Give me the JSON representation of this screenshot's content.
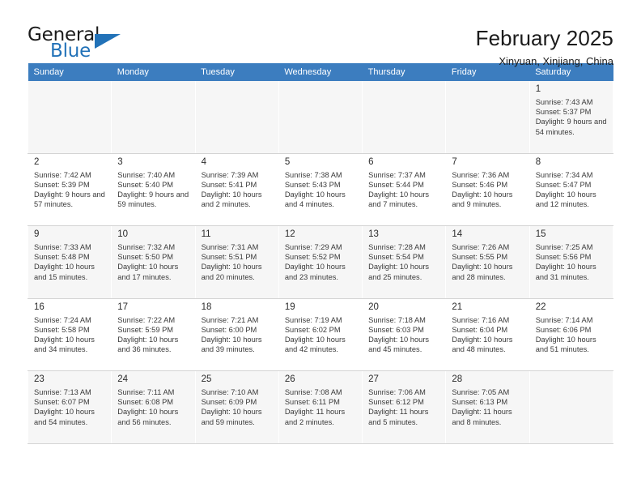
{
  "brand": {
    "name_top": "General",
    "name_bottom": "Blue",
    "accent_color": "#2272b8"
  },
  "header": {
    "title": "February 2025",
    "subtitle": "Xinyuan, Xinjiang, China"
  },
  "theme": {
    "header_row_bg": "#3c7dbf",
    "alt_row_bg": "#f6f6f6",
    "empty_cell_bg": "#f1f1f1"
  },
  "weekdays": [
    "Sunday",
    "Monday",
    "Tuesday",
    "Wednesday",
    "Thursday",
    "Friday",
    "Saturday"
  ],
  "labels": {
    "sunrise_prefix": "Sunrise: ",
    "sunset_prefix": "Sunset: ",
    "daylight_prefix": "Daylight: "
  },
  "weeks": [
    [
      {
        "empty": true
      },
      {
        "empty": true
      },
      {
        "empty": true
      },
      {
        "empty": true
      },
      {
        "empty": true
      },
      {
        "empty": true
      },
      {
        "day": "1",
        "sunrise": "Sunrise: 7:43 AM",
        "sunset": "Sunset: 5:37 PM",
        "daylight": "Daylight: 9 hours and 54 minutes."
      }
    ],
    [
      {
        "day": "2",
        "sunrise": "Sunrise: 7:42 AM",
        "sunset": "Sunset: 5:39 PM",
        "daylight": "Daylight: 9 hours and 57 minutes."
      },
      {
        "day": "3",
        "sunrise": "Sunrise: 7:40 AM",
        "sunset": "Sunset: 5:40 PM",
        "daylight": "Daylight: 9 hours and 59 minutes."
      },
      {
        "day": "4",
        "sunrise": "Sunrise: 7:39 AM",
        "sunset": "Sunset: 5:41 PM",
        "daylight": "Daylight: 10 hours and 2 minutes."
      },
      {
        "day": "5",
        "sunrise": "Sunrise: 7:38 AM",
        "sunset": "Sunset: 5:43 PM",
        "daylight": "Daylight: 10 hours and 4 minutes."
      },
      {
        "day": "6",
        "sunrise": "Sunrise: 7:37 AM",
        "sunset": "Sunset: 5:44 PM",
        "daylight": "Daylight: 10 hours and 7 minutes."
      },
      {
        "day": "7",
        "sunrise": "Sunrise: 7:36 AM",
        "sunset": "Sunset: 5:46 PM",
        "daylight": "Daylight: 10 hours and 9 minutes."
      },
      {
        "day": "8",
        "sunrise": "Sunrise: 7:34 AM",
        "sunset": "Sunset: 5:47 PM",
        "daylight": "Daylight: 10 hours and 12 minutes."
      }
    ],
    [
      {
        "day": "9",
        "sunrise": "Sunrise: 7:33 AM",
        "sunset": "Sunset: 5:48 PM",
        "daylight": "Daylight: 10 hours and 15 minutes."
      },
      {
        "day": "10",
        "sunrise": "Sunrise: 7:32 AM",
        "sunset": "Sunset: 5:50 PM",
        "daylight": "Daylight: 10 hours and 17 minutes."
      },
      {
        "day": "11",
        "sunrise": "Sunrise: 7:31 AM",
        "sunset": "Sunset: 5:51 PM",
        "daylight": "Daylight: 10 hours and 20 minutes."
      },
      {
        "day": "12",
        "sunrise": "Sunrise: 7:29 AM",
        "sunset": "Sunset: 5:52 PM",
        "daylight": "Daylight: 10 hours and 23 minutes."
      },
      {
        "day": "13",
        "sunrise": "Sunrise: 7:28 AM",
        "sunset": "Sunset: 5:54 PM",
        "daylight": "Daylight: 10 hours and 25 minutes."
      },
      {
        "day": "14",
        "sunrise": "Sunrise: 7:26 AM",
        "sunset": "Sunset: 5:55 PM",
        "daylight": "Daylight: 10 hours and 28 minutes."
      },
      {
        "day": "15",
        "sunrise": "Sunrise: 7:25 AM",
        "sunset": "Sunset: 5:56 PM",
        "daylight": "Daylight: 10 hours and 31 minutes."
      }
    ],
    [
      {
        "day": "16",
        "sunrise": "Sunrise: 7:24 AM",
        "sunset": "Sunset: 5:58 PM",
        "daylight": "Daylight: 10 hours and 34 minutes."
      },
      {
        "day": "17",
        "sunrise": "Sunrise: 7:22 AM",
        "sunset": "Sunset: 5:59 PM",
        "daylight": "Daylight: 10 hours and 36 minutes."
      },
      {
        "day": "18",
        "sunrise": "Sunrise: 7:21 AM",
        "sunset": "Sunset: 6:00 PM",
        "daylight": "Daylight: 10 hours and 39 minutes."
      },
      {
        "day": "19",
        "sunrise": "Sunrise: 7:19 AM",
        "sunset": "Sunset: 6:02 PM",
        "daylight": "Daylight: 10 hours and 42 minutes."
      },
      {
        "day": "20",
        "sunrise": "Sunrise: 7:18 AM",
        "sunset": "Sunset: 6:03 PM",
        "daylight": "Daylight: 10 hours and 45 minutes."
      },
      {
        "day": "21",
        "sunrise": "Sunrise: 7:16 AM",
        "sunset": "Sunset: 6:04 PM",
        "daylight": "Daylight: 10 hours and 48 minutes."
      },
      {
        "day": "22",
        "sunrise": "Sunrise: 7:14 AM",
        "sunset": "Sunset: 6:06 PM",
        "daylight": "Daylight: 10 hours and 51 minutes."
      }
    ],
    [
      {
        "day": "23",
        "sunrise": "Sunrise: 7:13 AM",
        "sunset": "Sunset: 6:07 PM",
        "daylight": "Daylight: 10 hours and 54 minutes."
      },
      {
        "day": "24",
        "sunrise": "Sunrise: 7:11 AM",
        "sunset": "Sunset: 6:08 PM",
        "daylight": "Daylight: 10 hours and 56 minutes."
      },
      {
        "day": "25",
        "sunrise": "Sunrise: 7:10 AM",
        "sunset": "Sunset: 6:09 PM",
        "daylight": "Daylight: 10 hours and 59 minutes."
      },
      {
        "day": "26",
        "sunrise": "Sunrise: 7:08 AM",
        "sunset": "Sunset: 6:11 PM",
        "daylight": "Daylight: 11 hours and 2 minutes."
      },
      {
        "day": "27",
        "sunrise": "Sunrise: 7:06 AM",
        "sunset": "Sunset: 6:12 PM",
        "daylight": "Daylight: 11 hours and 5 minutes."
      },
      {
        "day": "28",
        "sunrise": "Sunrise: 7:05 AM",
        "sunset": "Sunset: 6:13 PM",
        "daylight": "Daylight: 11 hours and 8 minutes."
      },
      {
        "empty": true
      }
    ]
  ]
}
